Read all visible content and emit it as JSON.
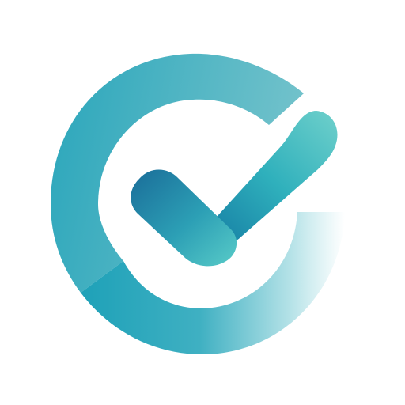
{
  "logo": {
    "icon": "check-circle-logo-icon",
    "colors": {
      "teal_dark": "#1595b0",
      "teal_mid": "#33a9bd",
      "teal_light": "#6dcfcd",
      "ring_top": "#6cbfc9",
      "ring_left": "#29a4bb",
      "check_short_start": "#1a6f9a",
      "check_short_end": "#4cc3c6",
      "check_long_start": "#1789a9",
      "check_long_end": "#69cccc",
      "background": "#ffffff"
    }
  }
}
